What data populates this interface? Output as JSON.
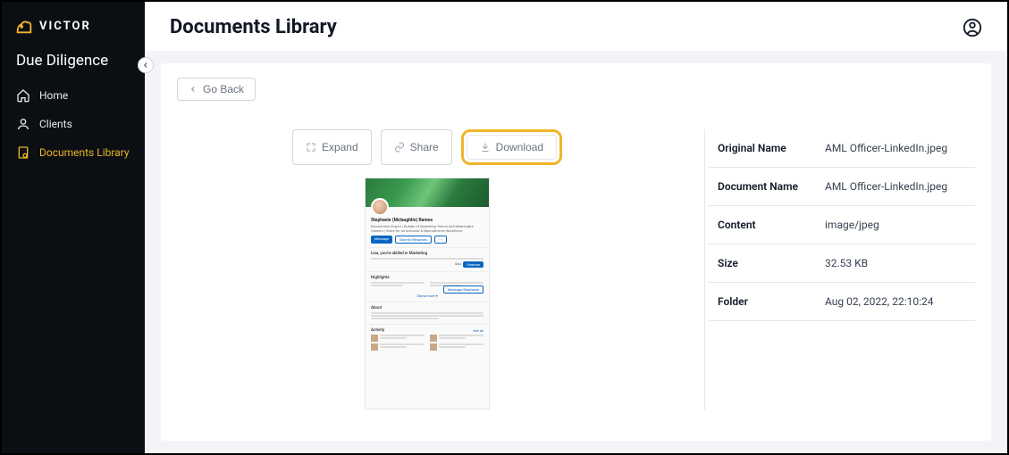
{
  "brand": {
    "name": "VICTOR"
  },
  "section": "Due Diligence",
  "nav": [
    {
      "name": "home",
      "label": "Home"
    },
    {
      "name": "clients",
      "label": "Clients"
    },
    {
      "name": "documents-library",
      "label": "Documents Library",
      "active": true
    }
  ],
  "page": {
    "title": "Documents Library"
  },
  "back": {
    "label": "Go Back"
  },
  "actions": {
    "expand": "Expand",
    "share": "Share",
    "download": "Download"
  },
  "meta": {
    "original_name": {
      "key": "Original Name",
      "val": "AML Officer-LinkedIn.jpeg"
    },
    "document_name": {
      "key": "Document Name",
      "val": "AML Officer-LinkedIn.jpeg"
    },
    "content": {
      "key": "Content",
      "val": "image/jpeg"
    },
    "size": {
      "key": "Size",
      "val": "32.53 KB"
    },
    "folder": {
      "key": "Folder",
      "val": "Aug 02, 2022, 22:10:24"
    }
  },
  "preview": {
    "profile_name": "Stephanie (Mclaughlin) Ramos",
    "headline": "Recruitment Expert | Builder of Marketing Teams and Meaningful Careers | Voice for an Inclusive & Neurodiverse Workforce",
    "skills_prompt": "Lisa, you're skilled in Marketing",
    "highlights": "Highlights",
    "about": "About",
    "activity": "Activity"
  }
}
